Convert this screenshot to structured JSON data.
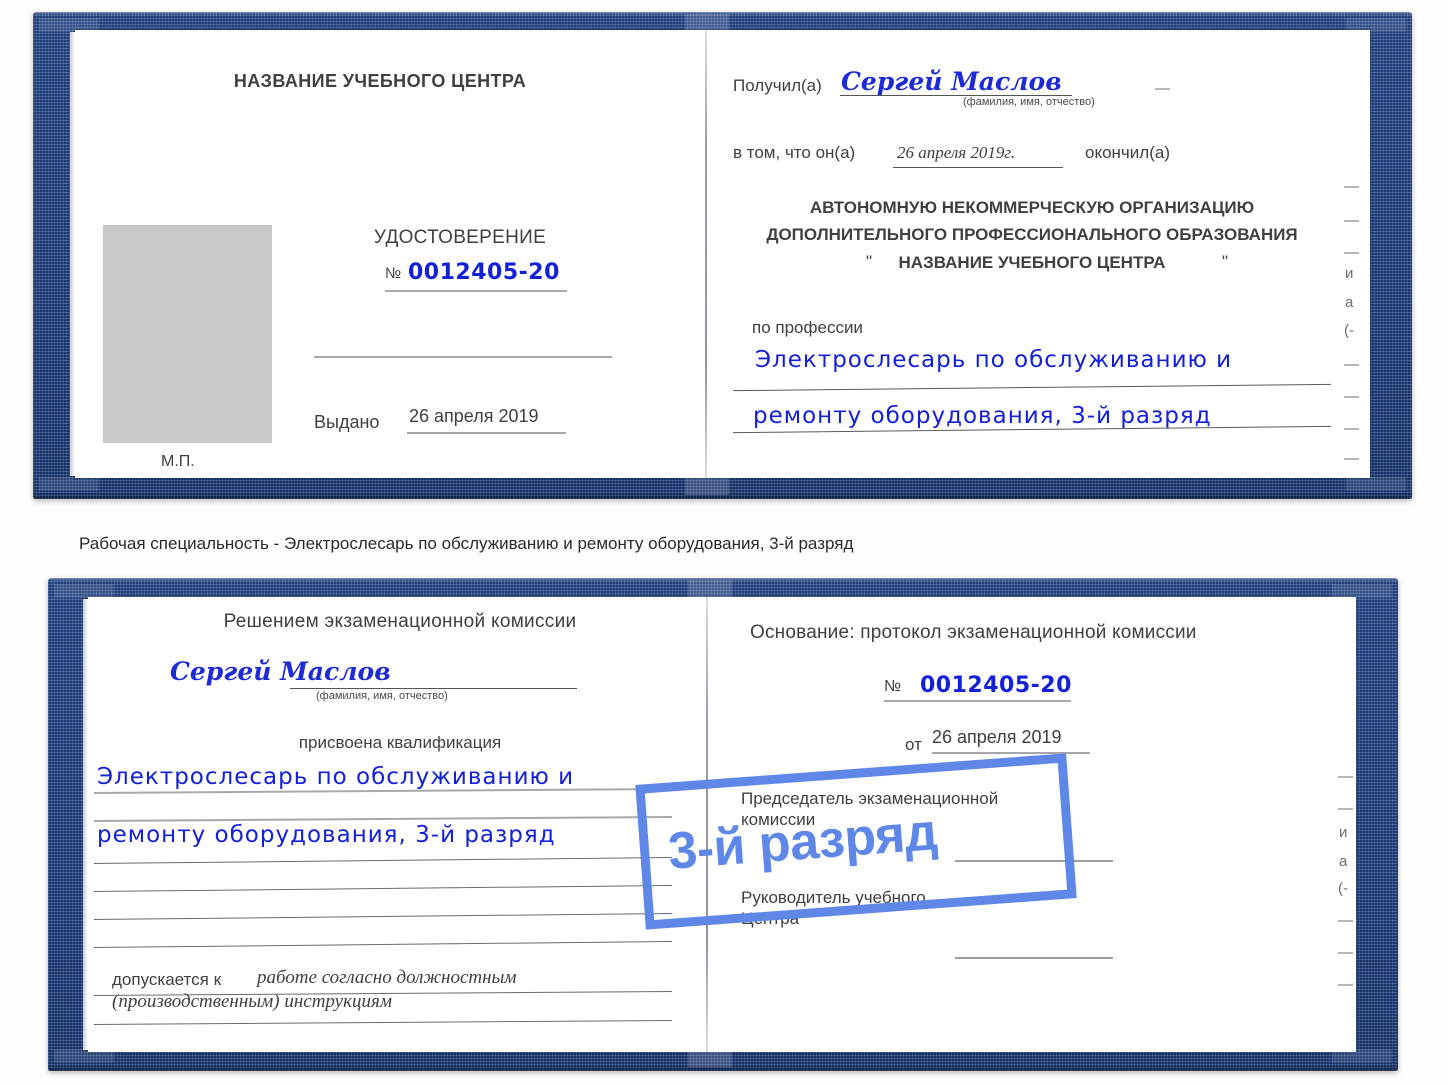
{
  "document": {
    "type": "certificate-scan",
    "caption": "Рабочая специальность - Электрослесарь по обслуживанию и ремонту оборудования, 3-й разряд",
    "badge": {
      "label": "3-й разряд",
      "color": "#5f87e8"
    },
    "colors": {
      "cover": "#24478c",
      "handwriting": "#1420d8",
      "text": "#3f3f44",
      "accent": "#5f87e8",
      "photo_placeholder": "#c7c8ca"
    }
  },
  "certificate_top": {
    "left_page": {
      "org_title": "НАЗВАНИЕ УЧЕБНОГО ЦЕНТРА",
      "doc_type": "УДОСТОВЕРЕНИЕ",
      "number_label": "№",
      "number_value": "0012405-20",
      "issued_label": "Выдано",
      "issued_value": "26 апреля 2019",
      "stamp_label": "М.П."
    },
    "right_page": {
      "received_label": "Получил(а)",
      "received_value": "Сергей Маслов",
      "fio_hint": "(фамилия, имя, отчество)",
      "statement_label": "в том, что он(а)",
      "statement_date": "26 апреля 2019г.",
      "statement_tail": "окончил(а)",
      "org_line1": "АВТОНОМНУЮ НЕКОММЕРЧЕСКУЮ ОРГАНИЗАЦИЮ",
      "org_line2": "ДОПОЛНИТЕЛЬНОГО ПРОФЕССИОНАЛЬНОГО ОБРАЗОВАНИЯ",
      "org_quote_open": "\"",
      "org_line3": "НАЗВАНИЕ УЧЕБНОГО ЦЕНТРА",
      "org_quote_close": "\"",
      "profession_label": "по профессии",
      "profession_line1": "Электрослесарь по обслуживанию и",
      "profession_line2": "ремонту оборудования, 3-й разряд",
      "edge_fragments": [
        "—",
        "—",
        "—",
        "и",
        "а",
        "(-",
        "—",
        "—",
        "—",
        "—"
      ]
    }
  },
  "certificate_bottom": {
    "left_page": {
      "heading": "Решением экзаменационной комиссии",
      "name_value": "Сергей Маслов",
      "fio_hint": "(фамилия, имя, отчество)",
      "qualification_label": "присвоена квалификация",
      "qualification_line1": "Электрослесарь по обслуживанию и",
      "qualification_line2": "ремонту оборудования, 3-й разряд",
      "admitted_label": "допускается к",
      "admitted_line1": "работе согласно должностным",
      "admitted_line2": "(производственным) инструкциям"
    },
    "right_page": {
      "basis_label": "Основание: протокол экзаменационной комиссии",
      "number_label": "№",
      "number_value": "0012405-20",
      "date_label": "от",
      "date_value": "26 апреля 2019",
      "chairman_line1": "Председатель экзаменационной",
      "chairman_line2": "комиссии",
      "head_line1": "Руководитель учебного",
      "head_line2": "Центра",
      "edge_fragments": [
        "—",
        "—",
        "и",
        "а",
        "(-",
        "—",
        "—",
        "—"
      ]
    }
  }
}
